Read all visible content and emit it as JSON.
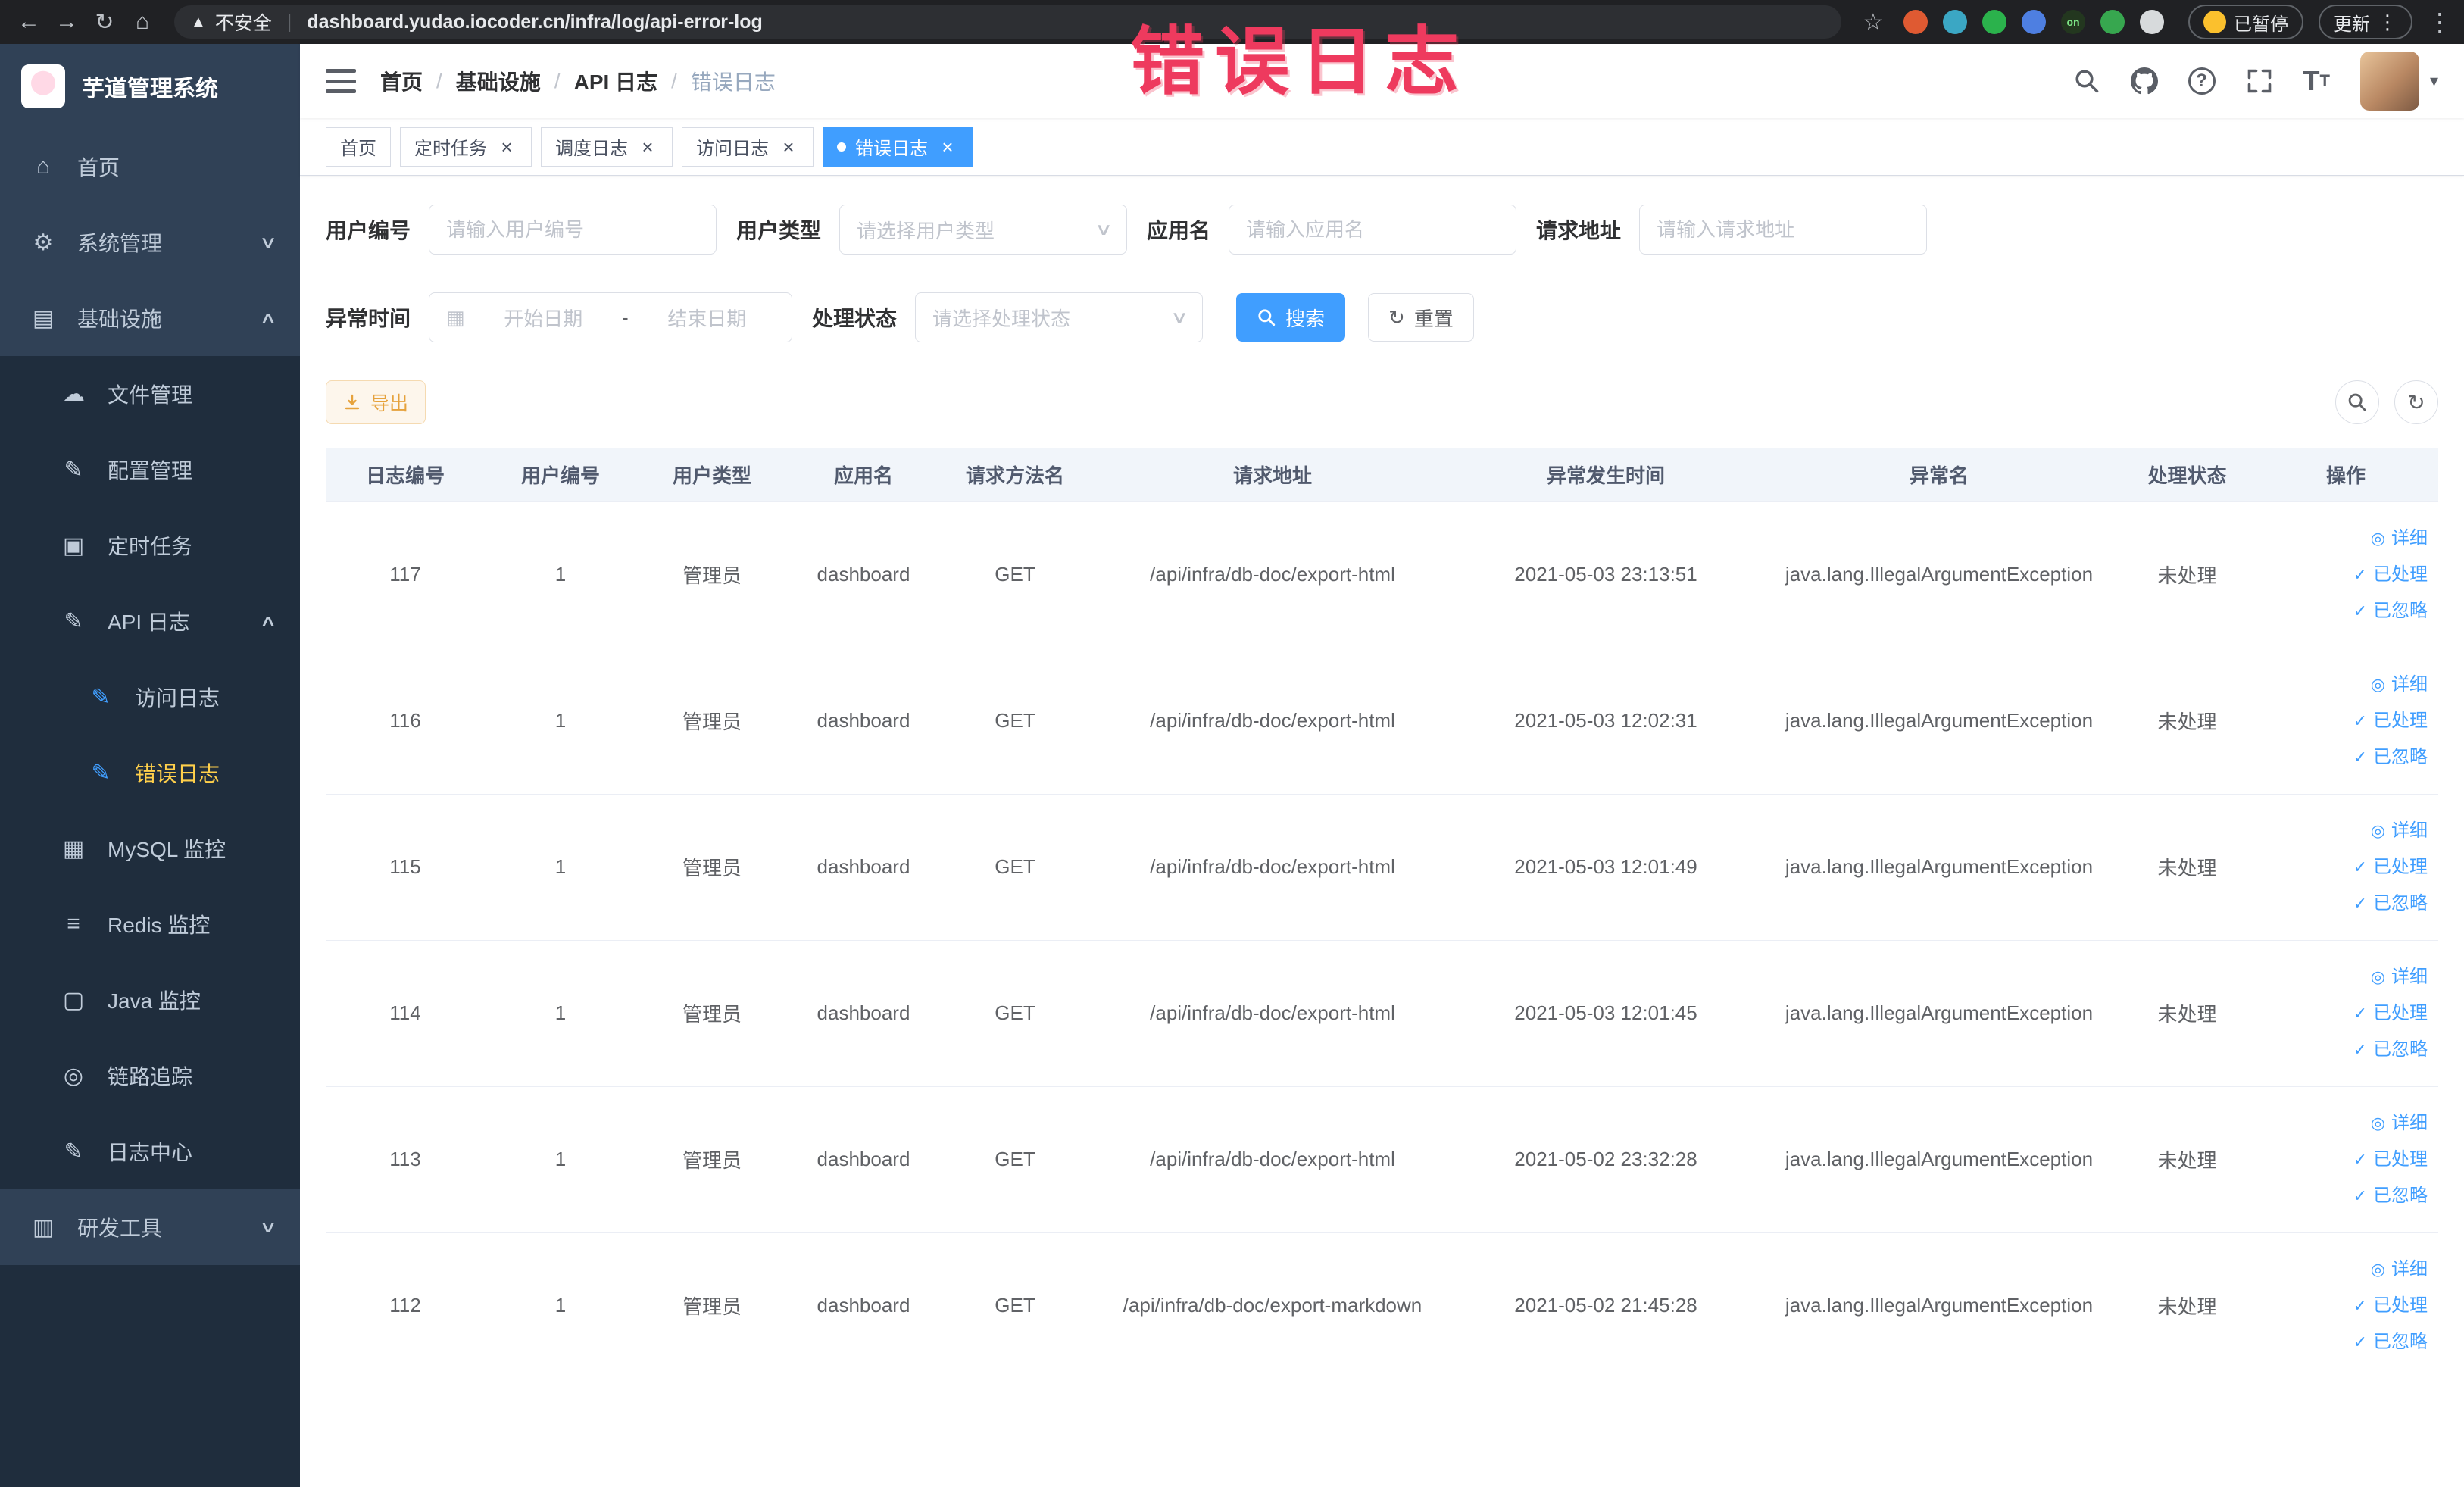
{
  "annotation": {
    "label": "错误日志",
    "color": "#ee3a5e"
  },
  "browser": {
    "security": "不安全",
    "url": "dashboard.yudao.iocoder.cn/infra/log/api-error-log",
    "paused_badge": "已暂停",
    "update_button": "更新",
    "extensions": [
      {
        "name": "extension-icon-orange",
        "color": "#df5a32"
      },
      {
        "name": "extension-icon-teal",
        "color": "#3ba7c4"
      },
      {
        "name": "extension-icon-green",
        "color": "#2bb24c"
      },
      {
        "name": "extension-icon-blue",
        "color": "#4e7fe1"
      },
      {
        "name": "extension-icon-on-badge",
        "color": "#23371f",
        "text": "on"
      },
      {
        "name": "extension-icon-leaf",
        "color": "#37a74f"
      },
      {
        "name": "extension-icon-paw",
        "color": "#d7dadc"
      }
    ]
  },
  "sidebar": {
    "title": "芋道管理系统",
    "items": [
      {
        "label": "首页",
        "icon": "home-icon",
        "level": 1
      },
      {
        "label": "系统管理",
        "icon": "gear-icon",
        "level": 1,
        "arrow": "down"
      },
      {
        "label": "基础设施",
        "icon": "infrastructure-icon",
        "level": 1,
        "arrow": "up"
      },
      {
        "label": "文件管理",
        "icon": "file-manage-icon",
        "level": 2
      },
      {
        "label": "配置管理",
        "icon": "config-manage-icon",
        "level": 2
      },
      {
        "label": "定时任务",
        "icon": "scheduled-job-icon",
        "level": 2
      },
      {
        "label": "API 日志",
        "icon": "api-log-icon",
        "level": 2,
        "arrow": "up"
      },
      {
        "label": "访问日志",
        "icon": "access-log-icon",
        "level": 3,
        "icon_color": "#409eff"
      },
      {
        "label": "错误日志",
        "icon": "error-log-icon",
        "level": 3,
        "icon_color": "#409eff",
        "active": true
      },
      {
        "label": "MySQL 监控",
        "icon": "mysql-monitor-icon",
        "level": 2
      },
      {
        "label": "Redis 监控",
        "icon": "redis-monitor-icon",
        "level": 2
      },
      {
        "label": "Java 监控",
        "icon": "java-monitor-icon",
        "level": 2
      },
      {
        "label": "链路追踪",
        "icon": "trace-icon",
        "level": 2
      },
      {
        "label": "日志中心",
        "icon": "log-center-icon",
        "level": 2
      },
      {
        "label": "研发工具",
        "icon": "dev-tools-icon",
        "level": 1,
        "arrow": "down"
      }
    ]
  },
  "header": {
    "breadcrumb": [
      "首页",
      "基础设施",
      "API 日志",
      "错误日志"
    ]
  },
  "tabs": [
    {
      "label": "首页",
      "closable": false,
      "active": false
    },
    {
      "label": "定时任务",
      "closable": true,
      "active": false
    },
    {
      "label": "调度日志",
      "closable": true,
      "active": false
    },
    {
      "label": "访问日志",
      "closable": true,
      "active": false
    },
    {
      "label": "错误日志",
      "closable": true,
      "active": true
    }
  ],
  "filters": {
    "user_id": {
      "label": "用户编号",
      "placeholder": "请输入用户编号"
    },
    "user_type": {
      "label": "用户类型",
      "placeholder": "请选择用户类型"
    },
    "app_name": {
      "label": "应用名",
      "placeholder": "请输入应用名"
    },
    "request_url": {
      "label": "请求地址",
      "placeholder": "请输入请求地址"
    },
    "exception_time": {
      "label": "异常时间",
      "start_placeholder": "开始日期",
      "separator": "-",
      "end_placeholder": "结束日期"
    },
    "process_status": {
      "label": "处理状态",
      "placeholder": "请选择处理状态"
    },
    "search_button": "搜索",
    "reset_button": "重置"
  },
  "toolbar": {
    "export_button": "导出"
  },
  "table": {
    "columns": [
      "日志编号",
      "用户编号",
      "用户类型",
      "应用名",
      "请求方法名",
      "请求地址",
      "异常发生时间",
      "异常名",
      "处理状态",
      "操作"
    ],
    "action_labels": [
      "详细",
      "已处理",
      "已忽略"
    ],
    "rows": [
      {
        "id": "117",
        "user_id": "1",
        "user_type": "管理员",
        "app": "dashboard",
        "method": "GET",
        "url": "/api/infra/db-doc/export-html",
        "time": "2021-05-03 23:13:51",
        "exception": "java.lang.IllegalArgumentException",
        "status": "未处理"
      },
      {
        "id": "116",
        "user_id": "1",
        "user_type": "管理员",
        "app": "dashboard",
        "method": "GET",
        "url": "/api/infra/db-doc/export-html",
        "time": "2021-05-03 12:02:31",
        "exception": "java.lang.IllegalArgumentException",
        "status": "未处理"
      },
      {
        "id": "115",
        "user_id": "1",
        "user_type": "管理员",
        "app": "dashboard",
        "method": "GET",
        "url": "/api/infra/db-doc/export-html",
        "time": "2021-05-03 12:01:49",
        "exception": "java.lang.IllegalArgumentException",
        "status": "未处理"
      },
      {
        "id": "114",
        "user_id": "1",
        "user_type": "管理员",
        "app": "dashboard",
        "method": "GET",
        "url": "/api/infra/db-doc/export-html",
        "time": "2021-05-03 12:01:45",
        "exception": "java.lang.IllegalArgumentException",
        "status": "未处理"
      },
      {
        "id": "113",
        "user_id": "1",
        "user_type": "管理员",
        "app": "dashboard",
        "method": "GET",
        "url": "/api/infra/db-doc/export-html",
        "time": "2021-05-02 23:32:28",
        "exception": "java.lang.IllegalArgumentException",
        "status": "未处理"
      },
      {
        "id": "112",
        "user_id": "1",
        "user_type": "管理员",
        "app": "dashboard",
        "method": "GET",
        "url": "/api/infra/db-doc/export-markdown",
        "time": "2021-05-02 21:45:28",
        "exception": "java.lang.IllegalArgumentException",
        "status": "未处理"
      }
    ]
  }
}
